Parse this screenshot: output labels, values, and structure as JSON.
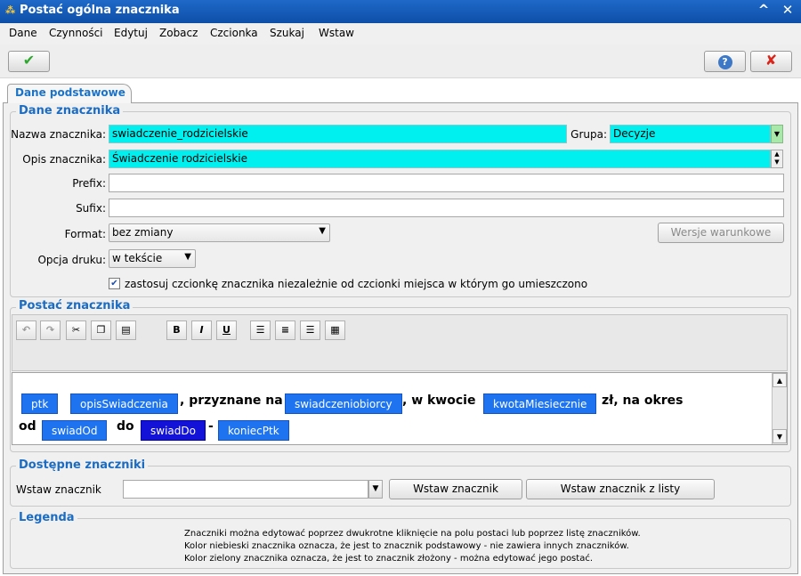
{
  "window": {
    "title": "Postać ogólna znacznika",
    "controls": {
      "minimize": "^",
      "close": "✕"
    }
  },
  "menu": [
    "Dane",
    "Czynności",
    "Edytuj",
    "Zobacz",
    "Czcionka",
    "Szukaj",
    "Wstaw"
  ],
  "toolbar": {
    "ok_icon": "check-icon",
    "help_icon": "help-icon",
    "cancel_icon": "close-icon",
    "ok_symbol": "✔",
    "help_symbol": "?",
    "cancel_symbol": "✘"
  },
  "tabs": [
    {
      "label": "Dane podstawowe"
    }
  ],
  "dane_znacznika": {
    "title": "Dane znacznika",
    "nazwa_label": "Nazwa znacznika:",
    "nazwa_value": "swiadczenie_rodzicielskie",
    "grupa_label": "Grupa:",
    "grupa_value": "Decyzje",
    "opis_label": "Opis znacznika:",
    "opis_value": "Świadczenie rodzicielskie",
    "prefix_label": "Prefix:",
    "prefix_value": "",
    "sufix_label": "Sufix:",
    "sufix_value": "",
    "format_label": "Format:",
    "format_value": "bez zmiany",
    "wersje_button": "Wersje warunkowe",
    "opcja_label": "Opcja druku:",
    "opcja_value": "w tekście",
    "checkbox_label": "zastosuj czcionkę znacznika niezależnie od czcionki miejsca w którym go umieszczono",
    "checkbox_checked": true
  },
  "postac_znacznika": {
    "title": "Postać znacznika",
    "toolbar_icons": [
      "undo-icon",
      "redo-icon",
      "cut-icon",
      "copy-icon",
      "paste-icon",
      "bold-icon",
      "italic-icon",
      "underline-icon",
      "align-left-icon",
      "align-center-icon",
      "align-right-icon",
      "align-justify-icon"
    ],
    "format_buttons": {
      "bold": "B",
      "italic": "I",
      "underline": "U"
    },
    "content": {
      "tags_line1": [
        "ptk",
        "opisSwiadczenia",
        "swiadczeniobiorcy",
        "kwotaMiesiecznie"
      ],
      "text_line1": [
        ", przyznane na",
        ", w kwocie",
        "zł, na okres"
      ],
      "text_line2": [
        "od",
        "do",
        "-"
      ],
      "tags_line2": [
        "swiadOd",
        "swiadDo",
        "koniecPtk"
      ]
    }
  },
  "dostepne": {
    "title": "Dostępne znaczniki",
    "wstaw_label": "Wstaw znacznik",
    "wstaw_value": "",
    "wstaw_button": "Wstaw znacznik",
    "wstaw_lista_button": "Wstaw znacznik z listy"
  },
  "legenda": {
    "title": "Legenda",
    "lines": [
      "Znaczniki można edytować poprzez dwukrotne kliknięcie na polu postaci lub poprzez listę znaczników.",
      "Kolor niebieski znacznika oznacza, że jest to znacznik podstawowy - nie zawiera innych znaczników.",
      "Kolor zielony znacznika oznacza, że jest to znacznik złożony - można edytować jego postać."
    ]
  },
  "colors": {
    "title_bar": "#1f69c8",
    "field_highlight": "#00f0f0",
    "tag_basic": "#1e74f0",
    "tag_selected": "#1212d8",
    "group_title": "#1b6cc2"
  }
}
